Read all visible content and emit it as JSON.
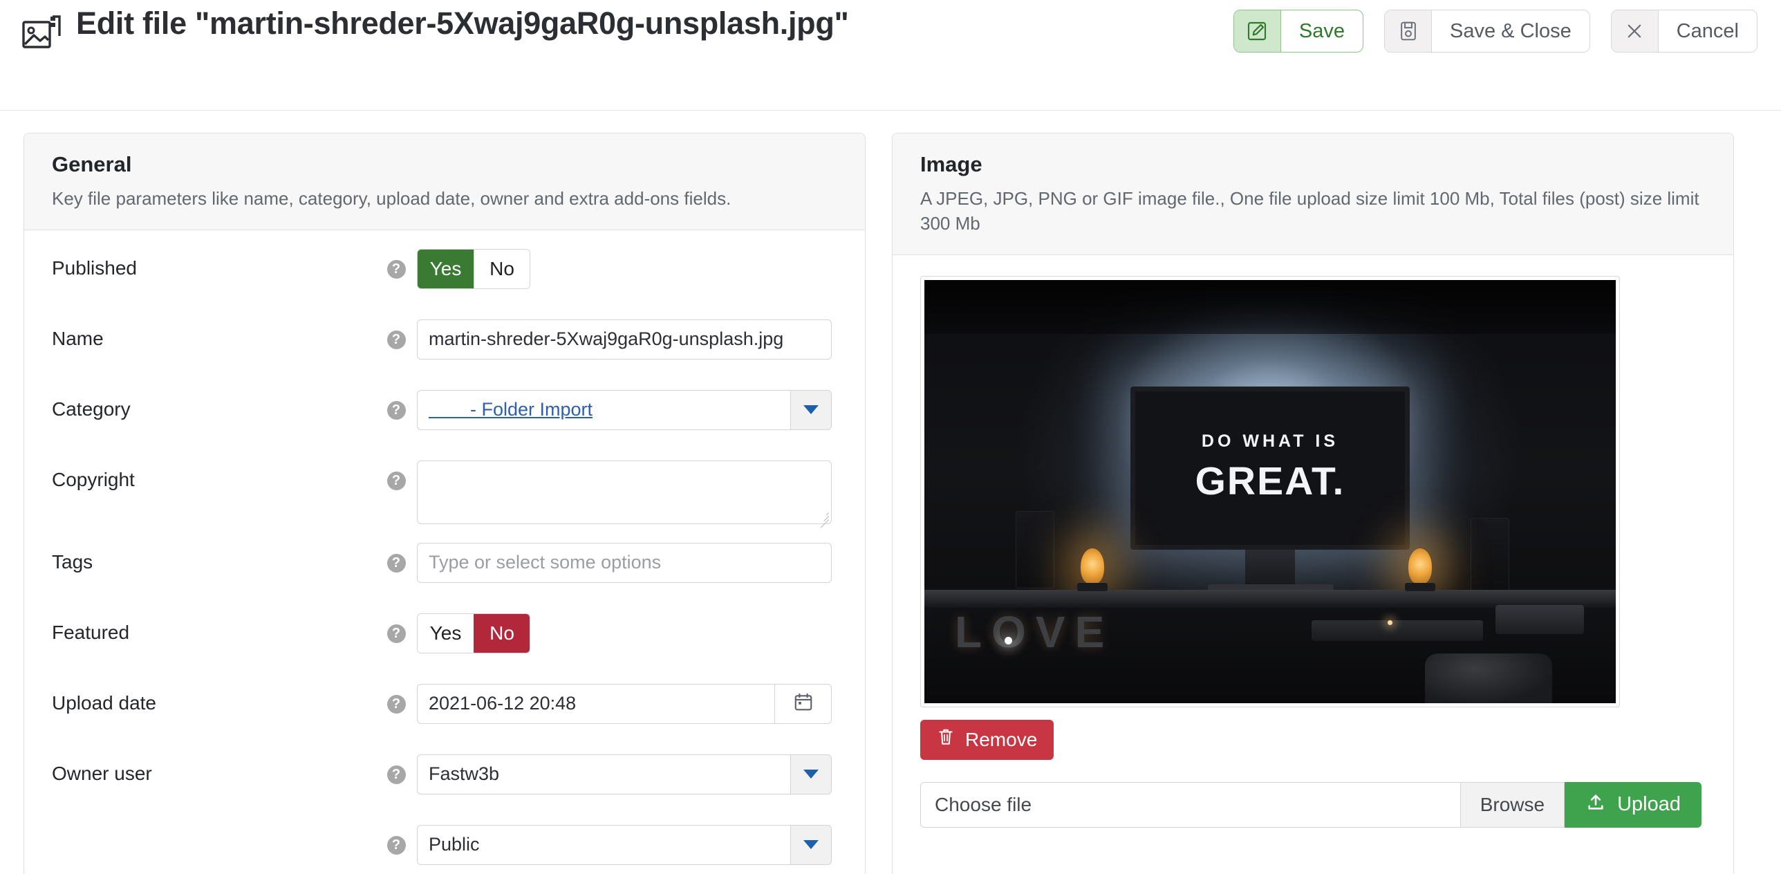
{
  "header": {
    "title": "Edit file \"martin-shreder-5Xwaj9gaR0g-unsplash.jpg\"",
    "icon": "image-file-icon",
    "buttons": [
      {
        "label": "Save",
        "icon": "edit-pencil-icon",
        "style": "green"
      },
      {
        "label": "Save & Close",
        "icon": "floppy-disk-icon",
        "style": "grey"
      },
      {
        "label": "Cancel",
        "icon": "close-x-icon",
        "style": "grey"
      }
    ]
  },
  "general_panel": {
    "title": "General",
    "subtitle": "Key file parameters like name, category, upload date, owner and extra add-ons fields.",
    "help_glyph": "?",
    "fields": {
      "published": {
        "label": "Published",
        "yes": "Yes",
        "no": "No",
        "selected": "Yes"
      },
      "name": {
        "label": "Name",
        "value": "martin-shreder-5Xwaj9gaR0g-unsplash.jpg"
      },
      "category": {
        "label": "Category",
        "value": "        - Folder Import"
      },
      "copyright": {
        "label": "Copyright",
        "value": ""
      },
      "tags": {
        "label": "Tags",
        "placeholder": "Type or select some options",
        "value": ""
      },
      "featured": {
        "label": "Featured",
        "yes": "Yes",
        "no": "No",
        "selected": "No"
      },
      "upload_date": {
        "label": "Upload date",
        "value": "2021-06-12 20:48",
        "icon": "calendar-icon"
      },
      "owner_user": {
        "label": "Owner user",
        "value": "Fastw3b"
      },
      "access_level": {
        "label": "",
        "value": "Public"
      }
    }
  },
  "image_panel": {
    "title": "Image",
    "subtitle": "A JPEG, JPG, PNG or GIF image file., One file upload size limit 100 Mb, Total files (post) size limit 300 Mb",
    "preview": {
      "alt": "dark desk setup with monitor and warm lamps",
      "monitor_line1": "DO WHAT IS",
      "monitor_line2": "GREAT.",
      "decor_word": "LOVE"
    },
    "remove_button": {
      "label": "Remove",
      "icon": "trash-icon",
      "color": "#c83543"
    },
    "upload": {
      "choose_label": "Choose file",
      "browse_label": "Browse",
      "upload_label": "Upload",
      "upload_icon": "upload-arrow-icon",
      "upload_color": "#3fa34d"
    }
  },
  "colors": {
    "green_active": "#3a7a33",
    "red_active": "#b3273a",
    "link_blue": "#2f5fa8"
  }
}
